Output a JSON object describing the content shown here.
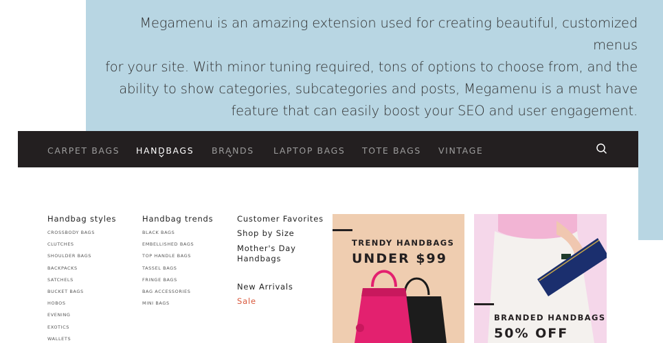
{
  "hero": {
    "line1": "Megamenu is an amazing extension used for creating beautiful, customized menus",
    "line2": "for your site. With minor tuning required, tons of options to choose from, and the",
    "line3": "ability to show categories, subcategories and posts, Megamenu is a must have",
    "line4": "feature that can easily boost your SEO and user engagement."
  },
  "nav": {
    "items": [
      {
        "label": "CARPET BAGS"
      },
      {
        "label": "HANDBAGS"
      },
      {
        "label": "BRANDS"
      },
      {
        "label": "LAPTOP BAGS"
      },
      {
        "label": "TOTE BAGS"
      },
      {
        "label": "VINTAGE"
      }
    ],
    "search_icon": "search-icon",
    "chevron_icon": "chevron-down-icon"
  },
  "megamenu": {
    "styles": {
      "title": "Handbag styles",
      "items": [
        "CROSSBODY BAGS",
        "CLUTCHES",
        "SHOULDER BAGS",
        "BACKPACKS",
        "SATCHELS",
        "BUCKET BAGS",
        "HOBOS",
        "EVENING",
        "EXOTICS",
        "WALLETS"
      ]
    },
    "trends": {
      "title": "Handbag trends",
      "items": [
        "BLACK BAGS",
        "EMBELLISHED BAGS",
        "TOP HANDLE BAGS",
        "TASSEL BAGS",
        "FRINGE BAGS",
        "BAG ACCESSORIES",
        "MINI BAGS"
      ]
    },
    "favorites": {
      "title": "Customer Favorites",
      "shop_by_size": "Shop by Size",
      "mothers_day_1": "Mother's Day",
      "mothers_day_2": "Handbags",
      "new_arrivals": "New Arrivals",
      "sale": "Sale"
    },
    "promo1": {
      "small": "TRENDY HANDBAGS",
      "big": "UNDER $99"
    },
    "promo2": {
      "small": "BRANDED HANDBAGS",
      "big": "50% OFF"
    }
  },
  "colors": {
    "hero_bg": "#b8d6e3",
    "navbar_bg": "#231f20",
    "sale": "#d9573b",
    "promo1_bg": "#efcdb0",
    "promo2_bg": "#f5d7ea",
    "bag_pink": "#e3216f",
    "clutch_navy": "#1b2f6e"
  }
}
